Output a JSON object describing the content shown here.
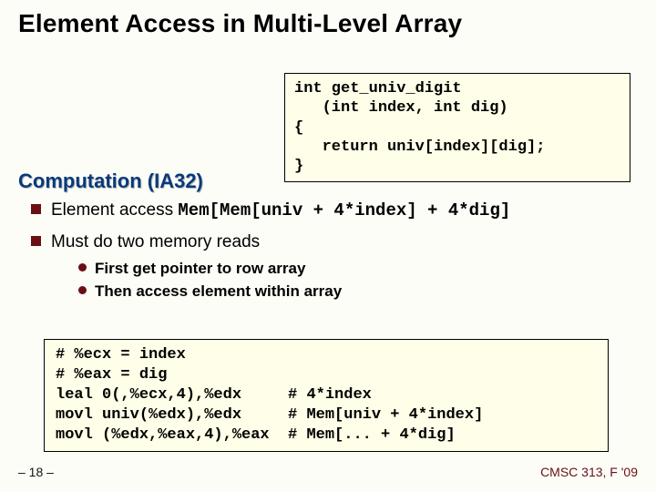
{
  "title": "Element Access in Multi-Level Array",
  "code1": "int get_univ_digit\n   (int index, int dig)\n{\n   return univ[index][dig];\n}",
  "section": "Computation (IA32)",
  "bullet1_pre": "Element access ",
  "bullet1_mono": "Mem[Mem[univ + 4*index] + 4*dig]",
  "bullet2": "Must do two memory reads",
  "sub1": "First get pointer to row array",
  "sub2": "Then access element within array",
  "asm": "# %ecx = index\n# %eax = dig\nleal 0(,%ecx,4),%edx     # 4*index\nmovl univ(%edx),%edx     # Mem[univ + 4*index]\nmovl (%edx,%eax,4),%eax  # Mem[... + 4*dig]",
  "pagenum": "– 18 –",
  "footer": "CMSC 313, F '09"
}
